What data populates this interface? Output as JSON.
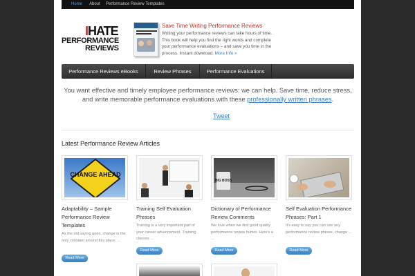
{
  "topnav": {
    "items": [
      {
        "label": "Home",
        "active": true
      },
      {
        "label": "About",
        "active": false
      },
      {
        "label": "Performance Review Templates",
        "active": false
      }
    ]
  },
  "logo": {
    "line1_i": "I",
    "line1_rest": "HATE",
    "line2": "PERFORMANCE",
    "line3": "REVIEWS"
  },
  "promo": {
    "title": "Save Time Writing Performance Reviews",
    "text": "Writing your performance reviews can take hours of time. This book will help you find the right words and complete your performance evaluations – and save you time in the process. Instant download.",
    "more": "More Info »"
  },
  "menu": {
    "items": [
      {
        "label": "Performance Reviews eBooks"
      },
      {
        "label": "Review Phrases"
      },
      {
        "label": "Performance Evaluations"
      }
    ]
  },
  "intro": {
    "text": "You want effective and timely employee performance reviews: we can help. Save time, reduce stress, and write memorable performance evaluations with these",
    "link": "professionally written phrases",
    "end": "."
  },
  "tweet": "Tweet",
  "section_title": "Latest Performance Review Articles",
  "articles": [
    {
      "title": "Adaptability – Sample Performance Review Templates",
      "excerpt": "As the old saying goes, change is the only constant around this place. ...",
      "image_text": "CHANGE AHEAD",
      "readmore": "Read More"
    },
    {
      "title": "Training Self Evaluation Phrases",
      "excerpt": "Training is a very important part of your career advancement. Training classes ...",
      "readmore": "Read More"
    },
    {
      "title": "Dictionary of Performance Review Comments",
      "excerpt": "We love when we find good quality performance review humor. Here's a ...",
      "image_text": "BIG BOSS",
      "readmore": "Read More"
    },
    {
      "title": "Self Evaluation Performance Phrases: Part 1",
      "excerpt": "It's easy to say you can use any performance review phrase, change ...",
      "readmore": "Read More"
    }
  ],
  "colors": {
    "accent": "#3a7fc1",
    "brand_red": "#c0302b",
    "menubar": "#3a3a3a",
    "background": "#2b2b2b"
  }
}
